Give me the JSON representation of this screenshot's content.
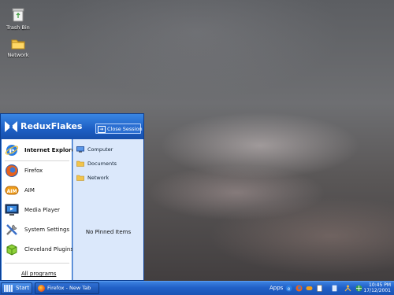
{
  "desktop": {
    "icons": [
      {
        "label": "Trash Bin",
        "icon": "trash-bin-icon"
      },
      {
        "label": "Network",
        "icon": "folder-icon"
      }
    ]
  },
  "start_menu": {
    "title": "ReduxFlakes",
    "close_label": "Close Session",
    "programs": [
      {
        "label": "Internet Explorer",
        "icon": "internet-explorer-icon"
      },
      {
        "label": "Firefox",
        "icon": "firefox-icon"
      },
      {
        "label": "AIM",
        "icon": "aim-icon"
      },
      {
        "label": "Media Player",
        "icon": "media-player-icon"
      },
      {
        "label": "System Settings",
        "icon": "system-settings-icon"
      },
      {
        "label": "Cleveland Plugins",
        "icon": "cleveland-plugins-icon"
      }
    ],
    "all_programs": "All programs",
    "places": [
      {
        "label": "Computer",
        "icon": "computer-icon"
      },
      {
        "label": "Documents",
        "icon": "documents-icon"
      },
      {
        "label": "Network",
        "icon": "network-icon"
      }
    ],
    "no_pinned": "No Pinned Items"
  },
  "taskbar": {
    "start_label": "Start",
    "tasks": [
      {
        "label": "Firefox - New Tab",
        "icon": "firefox-icon"
      }
    ],
    "apps_label": "Apps",
    "clock_time": "10:45 PM",
    "clock_date": "17/12/2001"
  },
  "colors": {
    "accent": "#1f66c9",
    "taskbar": "#2160c7",
    "menu_right_pane": "#dbe8fb"
  }
}
